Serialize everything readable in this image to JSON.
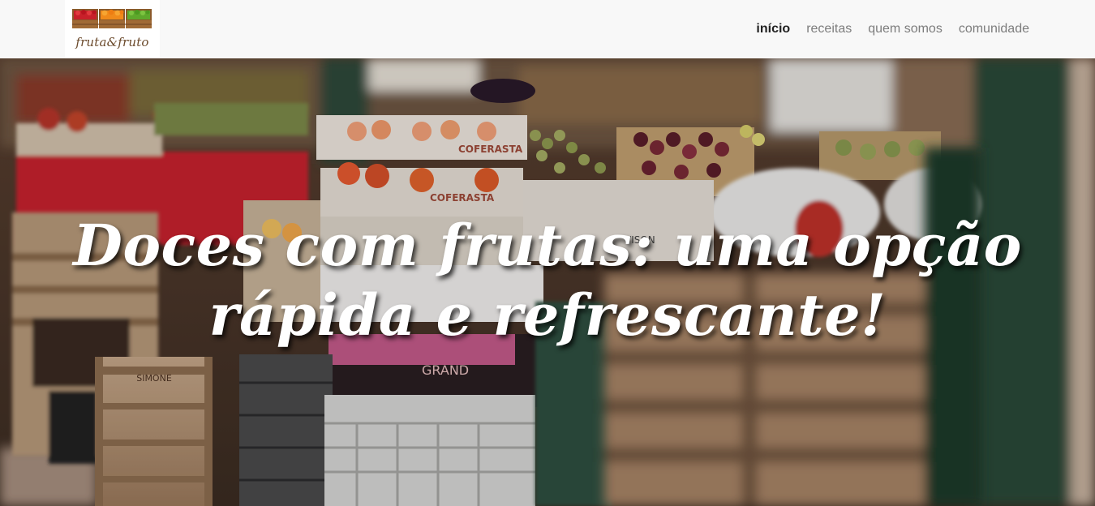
{
  "brand": {
    "logo_text": "fruta&fruto",
    "logo_icon": "fruit-crates-icon"
  },
  "nav": {
    "items": [
      {
        "label": "início",
        "active": true
      },
      {
        "label": "receitas",
        "active": false
      },
      {
        "label": "quem somos",
        "active": false
      },
      {
        "label": "comunidade",
        "active": false
      }
    ]
  },
  "hero": {
    "title": "Doces com frutas: uma opção rápida e refrescante!",
    "crate_labels": [
      "COFERASTA",
      "COFERASTA",
      "SIMONE",
      "GRAND",
      "VISON"
    ]
  },
  "colors": {
    "navbar_bg": "#f8f8f8",
    "nav_active": "#222222",
    "nav_inactive": "#7d7d7d",
    "hero_title": "#ffffff",
    "logo_text": "#6b4a2c"
  }
}
